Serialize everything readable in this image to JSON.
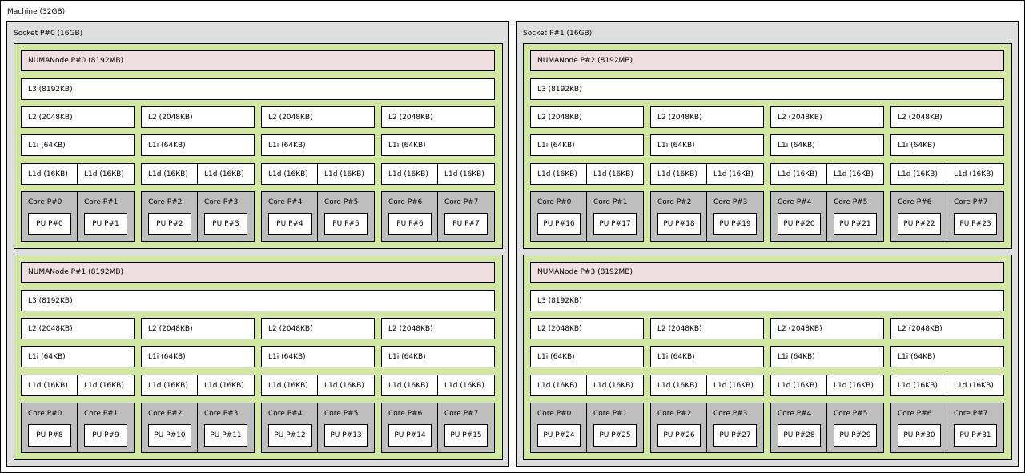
{
  "machine": {
    "label": "Machine (32GB)"
  },
  "sockets": [
    {
      "label": "Socket P#0 (16GB)",
      "numa_nodes": [
        {
          "label": "NUMANode P#0 (8192MB)",
          "l3": "L3 (8192KB)",
          "l2": [
            "L2 (2048KB)",
            "L2 (2048KB)",
            "L2 (2048KB)",
            "L2 (2048KB)"
          ],
          "l1i": [
            "L1i (64KB)",
            "L1i (64KB)",
            "L1i (64KB)",
            "L1i (64KB)"
          ],
          "l1d": [
            "L1d (16KB)",
            "L1d (16KB)",
            "L1d (16KB)",
            "L1d (16KB)",
            "L1d (16KB)",
            "L1d (16KB)",
            "L1d (16KB)",
            "L1d (16KB)"
          ],
          "cores": [
            {
              "label": "Core P#0",
              "pu": "PU P#0"
            },
            {
              "label": "Core P#1",
              "pu": "PU P#1"
            },
            {
              "label": "Core P#2",
              "pu": "PU P#2"
            },
            {
              "label": "Core P#3",
              "pu": "PU P#3"
            },
            {
              "label": "Core P#4",
              "pu": "PU P#4"
            },
            {
              "label": "Core P#5",
              "pu": "PU P#5"
            },
            {
              "label": "Core P#6",
              "pu": "PU P#6"
            },
            {
              "label": "Core P#7",
              "pu": "PU P#7"
            }
          ]
        },
        {
          "label": "NUMANode P#1 (8192MB)",
          "l3": "L3 (8192KB)",
          "l2": [
            "L2 (2048KB)",
            "L2 (2048KB)",
            "L2 (2048KB)",
            "L2 (2048KB)"
          ],
          "l1i": [
            "L1i (64KB)",
            "L1i (64KB)",
            "L1i (64KB)",
            "L1i (64KB)"
          ],
          "l1d": [
            "L1d (16KB)",
            "L1d (16KB)",
            "L1d (16KB)",
            "L1d (16KB)",
            "L1d (16KB)",
            "L1d (16KB)",
            "L1d (16KB)",
            "L1d (16KB)"
          ],
          "cores": [
            {
              "label": "Core P#0",
              "pu": "PU P#8"
            },
            {
              "label": "Core P#1",
              "pu": "PU P#9"
            },
            {
              "label": "Core P#2",
              "pu": "PU P#10"
            },
            {
              "label": "Core P#3",
              "pu": "PU P#11"
            },
            {
              "label": "Core P#4",
              "pu": "PU P#12"
            },
            {
              "label": "Core P#5",
              "pu": "PU P#13"
            },
            {
              "label": "Core P#6",
              "pu": "PU P#14"
            },
            {
              "label": "Core P#7",
              "pu": "PU P#15"
            }
          ]
        }
      ]
    },
    {
      "label": "Socket P#1 (16GB)",
      "numa_nodes": [
        {
          "label": "NUMANode P#2 (8192MB)",
          "l3": "L3 (8192KB)",
          "l2": [
            "L2 (2048KB)",
            "L2 (2048KB)",
            "L2 (2048KB)",
            "L2 (2048KB)"
          ],
          "l1i": [
            "L1i (64KB)",
            "L1i (64KB)",
            "L1i (64KB)",
            "L1i (64KB)"
          ],
          "l1d": [
            "L1d (16KB)",
            "L1d (16KB)",
            "L1d (16KB)",
            "L1d (16KB)",
            "L1d (16KB)",
            "L1d (16KB)",
            "L1d (16KB)",
            "L1d (16KB)"
          ],
          "cores": [
            {
              "label": "Core P#0",
              "pu": "PU P#16"
            },
            {
              "label": "Core P#1",
              "pu": "PU P#17"
            },
            {
              "label": "Core P#2",
              "pu": "PU P#18"
            },
            {
              "label": "Core P#3",
              "pu": "PU P#19"
            },
            {
              "label": "Core P#4",
              "pu": "PU P#20"
            },
            {
              "label": "Core P#5",
              "pu": "PU P#21"
            },
            {
              "label": "Core P#6",
              "pu": "PU P#22"
            },
            {
              "label": "Core P#7",
              "pu": "PU P#23"
            }
          ]
        },
        {
          "label": "NUMANode P#3 (8192MB)",
          "l3": "L3 (8192KB)",
          "l2": [
            "L2 (2048KB)",
            "L2 (2048KB)",
            "L2 (2048KB)",
            "L2 (2048KB)"
          ],
          "l1i": [
            "L1i (64KB)",
            "L1i (64KB)",
            "L1i (64KB)",
            "L1i (64KB)"
          ],
          "l1d": [
            "L1d (16KB)",
            "L1d (16KB)",
            "L1d (16KB)",
            "L1d (16KB)",
            "L1d (16KB)",
            "L1d (16KB)",
            "L1d (16KB)",
            "L1d (16KB)"
          ],
          "cores": [
            {
              "label": "Core P#0",
              "pu": "PU P#24"
            },
            {
              "label": "Core P#1",
              "pu": "PU P#25"
            },
            {
              "label": "Core P#2",
              "pu": "PU P#26"
            },
            {
              "label": "Core P#3",
              "pu": "PU P#27"
            },
            {
              "label": "Core P#4",
              "pu": "PU P#28"
            },
            {
              "label": "Core P#5",
              "pu": "PU P#29"
            },
            {
              "label": "Core P#6",
              "pu": "PU P#30"
            },
            {
              "label": "Core P#7",
              "pu": "PU P#31"
            }
          ]
        }
      ]
    }
  ],
  "colors": {
    "machine": "#ffffff",
    "socket": "#dedede",
    "numa_group": "#d2e7a4",
    "numa_node": "#efdfde",
    "cache": "#ffffff",
    "core": "#bebebe",
    "pu": "#ffffff"
  }
}
